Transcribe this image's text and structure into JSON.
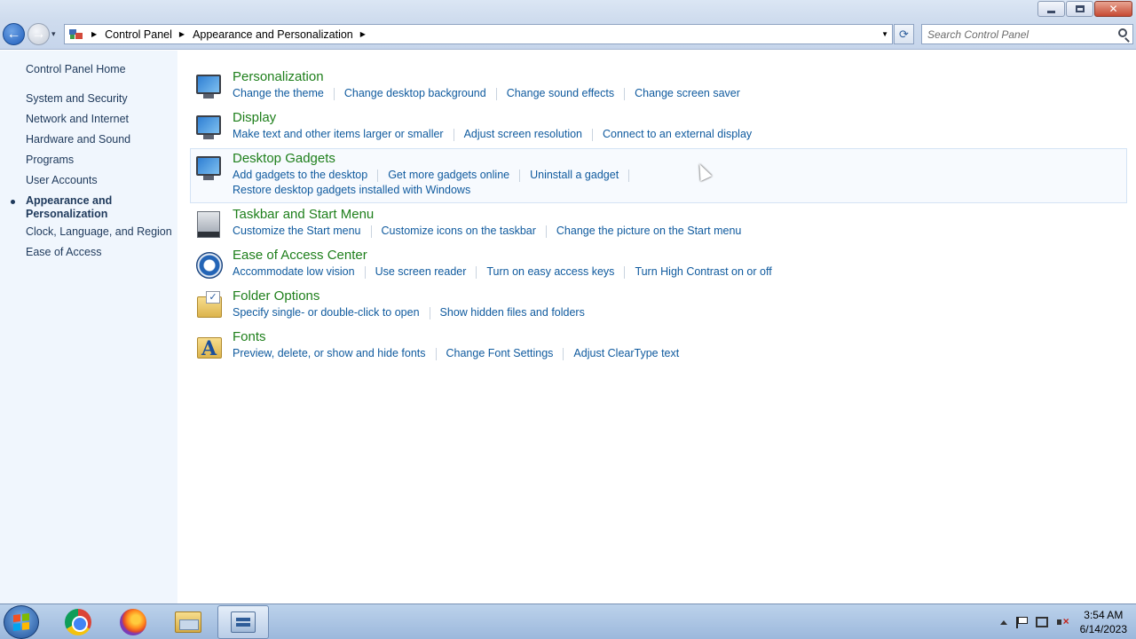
{
  "window": {
    "minimize_icon": "minimize-icon",
    "maximize_icon": "restore-icon",
    "close_label": "✕"
  },
  "nav": {
    "back_glyph": "←",
    "forward_glyph": "→",
    "recent_glyph": "▾",
    "breadcrumb": [
      "Control Panel",
      "Appearance and Personalization"
    ],
    "refresh_glyph": "⟳",
    "search_placeholder": "Search Control Panel"
  },
  "sidebar": {
    "home": "Control Panel Home",
    "items": [
      "System and Security",
      "Network and Internet",
      "Hardware and Sound",
      "Programs",
      "User Accounts"
    ],
    "current": "Appearance and Personalization",
    "items_after": [
      "Clock, Language, and Region",
      "Ease of Access"
    ]
  },
  "categories": [
    {
      "title": "Personalization",
      "icon": "personalization-icon",
      "links": [
        "Change the theme",
        "Change desktop background",
        "Change sound effects",
        "Change screen saver"
      ]
    },
    {
      "title": "Display",
      "icon": "display-icon",
      "links": [
        "Make text and other items larger or smaller",
        "Adjust screen resolution",
        "Connect to an external display"
      ]
    },
    {
      "title": "Desktop Gadgets",
      "icon": "desktop-gadgets-icon",
      "links": [
        "Add gadgets to the desktop",
        "Get more gadgets online",
        "Uninstall a gadget",
        "Restore desktop gadgets installed with Windows"
      ]
    },
    {
      "title": "Taskbar and Start Menu",
      "icon": "taskbar-icon",
      "links": [
        "Customize the Start menu",
        "Customize icons on the taskbar",
        "Change the picture on the Start menu"
      ]
    },
    {
      "title": "Ease of Access Center",
      "icon": "ease-of-access-icon",
      "links": [
        "Accommodate low vision",
        "Use screen reader",
        "Turn on easy access keys",
        "Turn High Contrast on or off"
      ]
    },
    {
      "title": "Folder Options",
      "icon": "folder-options-icon",
      "links": [
        "Specify single- or double-click to open",
        "Show hidden files and folders"
      ]
    },
    {
      "title": "Fonts",
      "icon": "fonts-icon",
      "links": [
        "Preview, delete, or show and hide fonts",
        "Change Font Settings",
        "Adjust ClearType text"
      ]
    }
  ],
  "taskbar": {
    "apps": [
      "chrome-icon",
      "firefox-icon",
      "file-explorer-icon",
      "control-panel-icon"
    ],
    "time": "3:54 AM",
    "date": "6/14/2023"
  },
  "colors": {
    "category_title": "#1e7f1b",
    "link": "#0f5a9e",
    "sidebar_bg": "#f0f6fd"
  }
}
